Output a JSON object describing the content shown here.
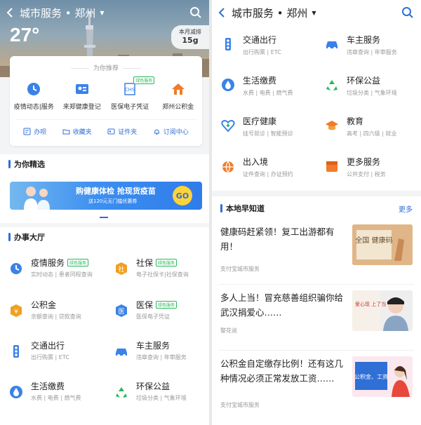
{
  "left": {
    "header": {
      "title": "城市服务 • 郑州",
      "temperature": "27°",
      "limit_label": "本月减排",
      "limit_value": "15g"
    },
    "recommend": {
      "heading": "为你推荐",
      "items": [
        {
          "label": "疫情动态|服务",
          "icon": "clock-shield-icon"
        },
        {
          "label": "来郑健康登记",
          "icon": "health-card-icon"
        },
        {
          "label": "医保电子凭证",
          "icon": "chs-icon",
          "tag": "绿色服务"
        },
        {
          "label": "郑州公积金",
          "icon": "house-icon"
        }
      ],
      "footer": [
        "办呗",
        "收藏夹",
        "证件夹",
        "订阅中心"
      ]
    },
    "picks_title": "为你精选",
    "banner": {
      "headline": "购健康体检 抢现货疫苗",
      "sub": "送120元无门槛优惠券",
      "go": "GO"
    },
    "hall_title": "办事大厅",
    "hall": [
      {
        "title": "疫情服务",
        "tag": "绿色服务",
        "sub": "实时动态 | 患者同程查询",
        "icon": "epidemic-icon"
      },
      {
        "title": "社保",
        "tag": "绿色服务",
        "sub": "电子社保卡|社保查询",
        "icon": "social-security-icon"
      },
      {
        "title": "公积金",
        "sub": "余额查询 | 贷款查询",
        "icon": "fund-icon"
      },
      {
        "title": "医保",
        "tag": "绿色服务",
        "sub": "医保电子凭证",
        "icon": "medical-insurance-icon"
      },
      {
        "title": "交通出行",
        "sub": "出行购票 | ETC",
        "icon": "traffic-light-icon"
      },
      {
        "title": "车主服务",
        "sub": "违章查询 | 年审服务",
        "icon": "car-icon"
      },
      {
        "title": "生活缴费",
        "sub": "水费 | 电费 | 燃气费",
        "icon": "drop-icon"
      },
      {
        "title": "环保公益",
        "sub": "垃圾分类 | 气象环境",
        "icon": "recycle-icon"
      }
    ]
  },
  "right": {
    "header": {
      "title": "城市服务 • 郑州"
    },
    "services": [
      {
        "title": "交通出行",
        "sub": "出行购票 | ETC",
        "icon": "traffic-light-icon"
      },
      {
        "title": "车主服务",
        "sub": "违章查询 | 年审服务",
        "icon": "car-icon"
      },
      {
        "title": "生活缴费",
        "sub": "水费 | 电费 | 燃气费",
        "icon": "drop-icon"
      },
      {
        "title": "环保公益",
        "sub": "垃圾分类 | 气象环境",
        "icon": "recycle-icon"
      },
      {
        "title": "医疗健康",
        "sub": "挂号就诊 | 智能预诊",
        "icon": "medical-heart-icon"
      },
      {
        "title": "教育",
        "sub": "高考 | 四六级 | 就业",
        "icon": "graduation-cap-icon"
      },
      {
        "title": "出入境",
        "sub": "证件查询 | 办证预约",
        "icon": "globe-plane-icon"
      },
      {
        "title": "更多服务",
        "sub": "公共支付 | 税务",
        "icon": "more-box-icon"
      }
    ],
    "local": {
      "title": "本地早知道",
      "more": "更多",
      "news": [
        {
          "title": "健康码赶紧领！复工出游都有用！",
          "source": "支付宝城市服务",
          "thumb_text": "全国 健康码"
        },
        {
          "title": "多人上当！冒充慈善组织骗你给武汉捐爱心……",
          "source": "警花说",
          "thumb_text": "爱心现 上了当 你转"
        },
        {
          "title": "公积金自定缴存比例！还有这几种情况必须正常发放工资……",
          "source": "支付宝城市服务",
          "thumb_text": "公积金、工资"
        }
      ]
    }
  },
  "colors": {
    "accent": "#2f6fd6",
    "green_tag": "#27b85b",
    "orange": "#f07c2a",
    "red": "#e8473b"
  }
}
